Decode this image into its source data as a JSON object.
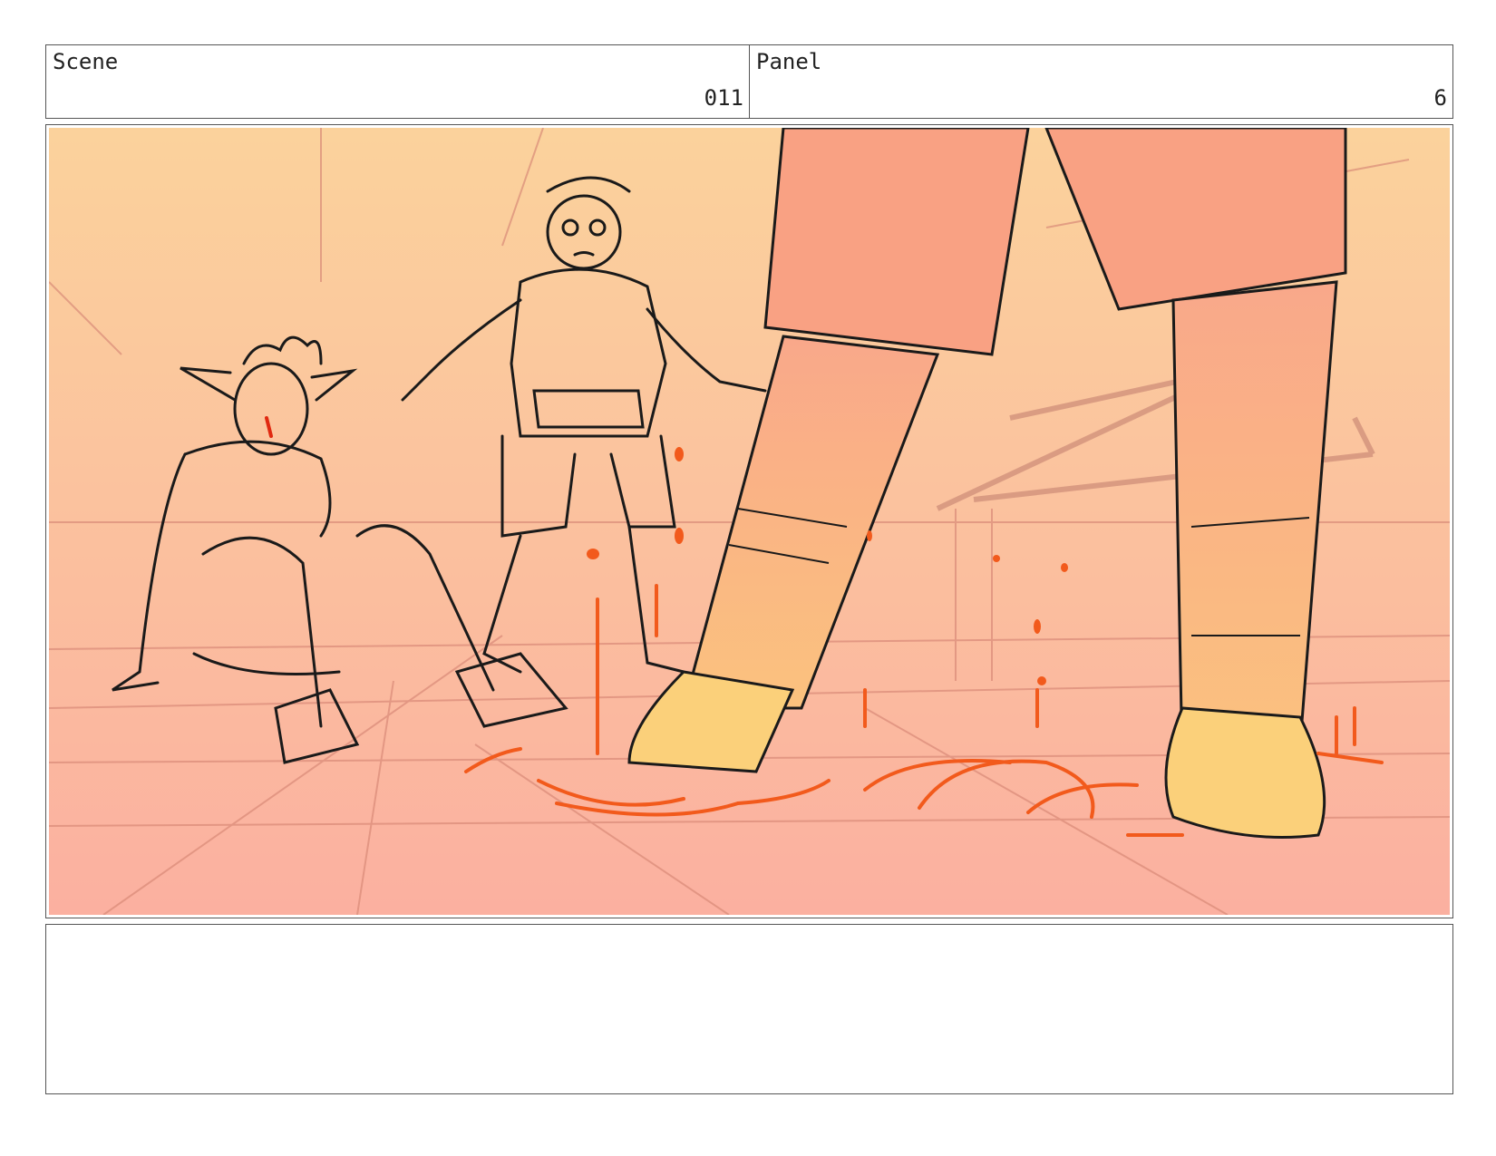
{
  "header": {
    "scene_label": "Scene",
    "scene_value": "011",
    "panel_label": "Panel",
    "panel_value": "6"
  },
  "colors": {
    "bg_top": "#fbd29c",
    "bg_bottom": "#fbb0a0",
    "shorts": "#f9a183",
    "shoe": "#fbd07a",
    "blood": "#f25a1c",
    "ink": "#1a1a1a"
  }
}
